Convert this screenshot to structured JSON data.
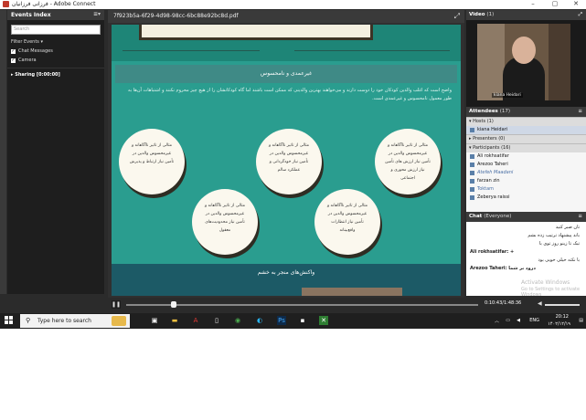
{
  "window": {
    "title": "فرزانی فرزانیان - Adobe Connect",
    "controls": [
      "–",
      "▢",
      "✕"
    ]
  },
  "events": {
    "title": "Events Index",
    "search_placeholder": "Search",
    "filter_label": "Filter Events ▾",
    "filters": [
      {
        "label": "Chat Messages",
        "checked": true
      },
      {
        "label": "Camera",
        "checked": true
      }
    ],
    "sharing": "Sharing [0:00:00]"
  },
  "document": {
    "filename": "7f923b5a-6f29-4d98-98cc-6bc88e92bc8d.pdf",
    "banner": "غیرعمدی و نامحسوس",
    "paragraph": "واضح است که اغلب والدین کودکان خود را دوست دارند و می‌خواهند بهترین والدینی که ممکن است باشند اما گاه کودکانشان را از هیچ چیز محروم نکنند و اشتباهات آن‌ها به طور معمول نامحسوس و غیرعمدی است.",
    "circles": [
      "مثالی از تاثیر ناآگاهانه و غیرمحسوس والدین در تأمین نیاز ارتباط و پذیرش",
      "مثالی از تاثیر ناآگاهانه و غیرمحسوس والدین در تأمین نیاز خودگردانی و عملکرد سالم",
      "مثالی از تاثیر ناآگاهانه و غیرمحسوس والدین در تأمین نیاز ارزش های تأمین نیاز ارزش محوری و اجتماعی",
      "مثالی از تاثیر ناآگاهانه و غیرمحسوس والدین در تأمین نیاز محدودیت‌های معقول",
      "مثالی از تاثیر ناآگاهانه و غیرمحسوس والدین در تأمین نیاز انتظارات واقع‌بینانه"
    ],
    "bottom_title": "واکنش‌های منجر به خشم"
  },
  "player": {
    "pause_icon": "❚❚",
    "progress": 0.1,
    "time": "0:10:43/1:48:36"
  },
  "video": {
    "title": "Video",
    "count": "(1)",
    "presenter": "kiana Heidari"
  },
  "attendees": {
    "title": "Attendees",
    "count": "(17)",
    "hosts_label": "Hosts (1)",
    "hosts": [
      "kiana Heidari"
    ],
    "presenters_label": "Presenters (0)",
    "participants_label": "Participants (16)",
    "participants": [
      "Ali rokhsatifar",
      "Arezoo Taheri",
      "Atefeh Maadani",
      "farzan zin",
      "Toktam",
      "Zeberya raissi"
    ]
  },
  "chat": {
    "title": "Chat",
    "scope": "(Everyone)",
    "messages": [
      "تان صبر کنید",
      "باند پیشنهاد ترتیب زده بشم",
      "تیک تا زینو روز توی با",
      "Ali rokhsatifar: +",
      "با نکته خیلی خوبی بود",
      "Arezoo Taheri: درود بر شما"
    ],
    "watermark_1": "Activate Windows",
    "watermark_2": "Go to Settings to activate Windows"
  },
  "taskbar": {
    "search_placeholder": "Type here to search",
    "tray_lang": "ENG",
    "time": "20:12",
    "date": "۱۴۰۲/۱۲/۱۹"
  }
}
